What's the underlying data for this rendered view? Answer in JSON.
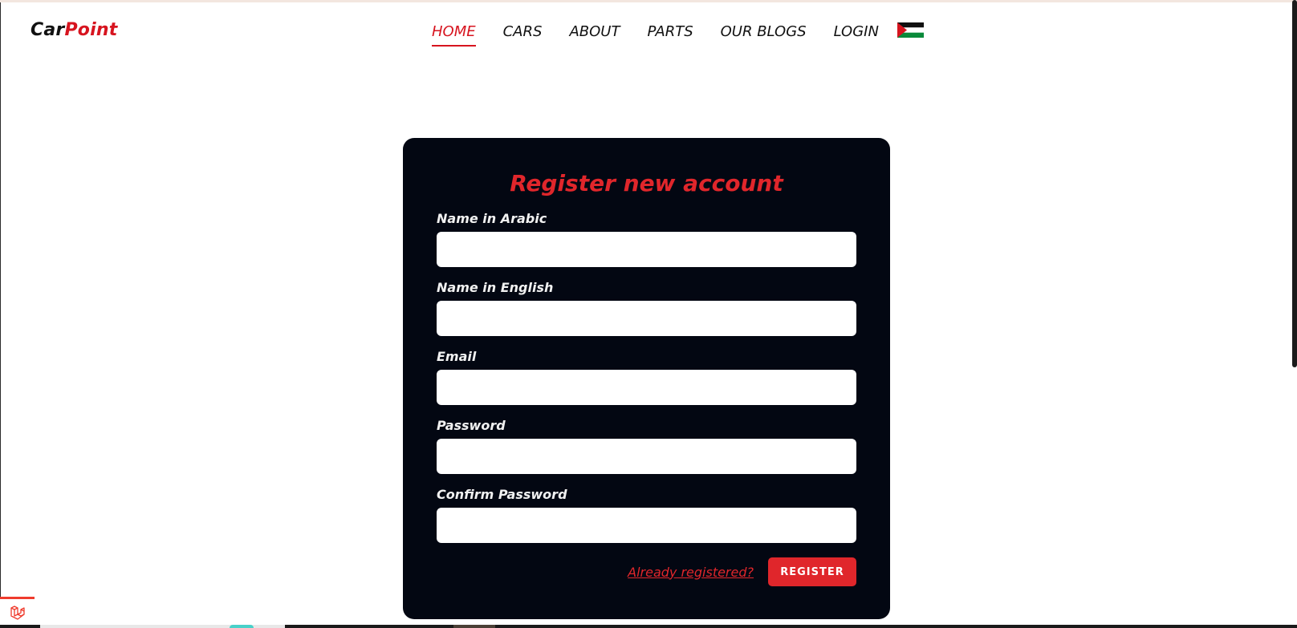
{
  "brand": {
    "part1": "Car",
    "part2": "Point"
  },
  "nav": {
    "items": [
      {
        "label": "HOME",
        "active": true
      },
      {
        "label": "CARS",
        "active": false
      },
      {
        "label": "ABOUT",
        "active": false
      },
      {
        "label": "PARTS",
        "active": false
      },
      {
        "label": "OUR BLOGS",
        "active": false
      },
      {
        "label": "LOGIN",
        "active": false
      }
    ],
    "language_flag": "palestine-flag-icon"
  },
  "form": {
    "title": "Register new account",
    "fields": [
      {
        "label": "Name in Arabic",
        "value": "",
        "type": "text"
      },
      {
        "label": "Name in English",
        "value": "",
        "type": "text"
      },
      {
        "label": "Email",
        "value": "",
        "type": "email"
      },
      {
        "label": "Password",
        "value": "",
        "type": "password"
      },
      {
        "label": "Confirm Password",
        "value": "",
        "type": "password"
      }
    ],
    "login_link": "Already registered?",
    "submit_label": "REGISTER"
  },
  "debug_badge_icon": "laravel-icon",
  "colors": {
    "accent": "#e0262b",
    "card_background": "#030712",
    "nav_active": "#d7141f",
    "text_dark": "#111111"
  }
}
